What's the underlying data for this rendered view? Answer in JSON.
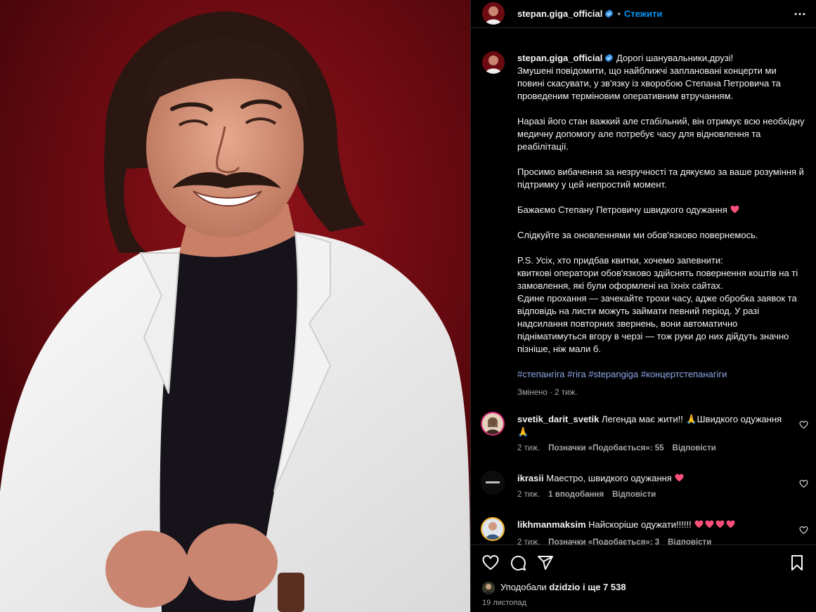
{
  "post": {
    "username": "stepan.giga_official",
    "follow_label": "Стежити",
    "dot": "•"
  },
  "caption": {
    "username": "stepan.giga_official",
    "lines": [
      "Дорогі шанувальники,друзі!\nЗмушені повідомити, що найближчі заплановані концерти ми повині скасувати, у зв'язку із хворобою Степана Петровича та проведеним терміновим оперативним втручанням.",
      "Наразі його стан важкий але стабільний, він отримує всю необхідну медичну допомогу але потребує часу для відновлення та реабілітації.",
      "Просимо вибачення за незручності та дякуємо за ваше розуміння й підтримку у цей непростий момент.",
      "Бажаємо Степану Петровичу швидкого одужання",
      "Слідкуйте за оновленнями ми обов'язково повернемось.",
      "P.S. Усіх, хто придбав квитки, хочемо запевнити:\nквиткові оператори обов'язково здійснять повернення коштів на ті замовлення, які були оформлені на їхніх сайтах.\nЄдине прохання — зачекайте трохи часу, адже обробка заявок та відповідь на листи можуть займати певний період. У разі надсилання повторних звернень, вони автоматично підніматимуться вгору в черзі — тож руки до них дійдуть значно пізніше, ніж мали б."
    ],
    "hashtags": "#степангіга #гіга #stepangiga #концертстепанагіги",
    "edited": "Змінено",
    "edited_sep": "·",
    "edited_ago": "2 тиж."
  },
  "comments": [
    {
      "username": "svetik_darit_svetik",
      "text": "Легенда має жити!! 🙏Швидкого одужання 🙏",
      "ago": "2 тиж.",
      "likes": "Позначки «Подобається»: 55",
      "reply": "Відповісти",
      "avatar_color": "#c9a27a"
    },
    {
      "username": "ikrasii",
      "text": "Маестро, швидкого одужання",
      "ago": "2 тиж.",
      "likes": "1 вподобання",
      "reply": "Відповісти",
      "avatar_color": "#111111"
    },
    {
      "username": "likhmanmaksim",
      "text": "Найскоріше одужати!!!!!!",
      "ago": "2 тиж.",
      "likes": "Позначки «Подобається»: 3",
      "reply": "Відповісти",
      "avatar_color": "#8aa0b8"
    }
  ],
  "footer": {
    "liked_by_prefix": "Уподобали",
    "liked_by_user": "dzidzio",
    "liked_by_suffix": "і ще 7 538",
    "date": "19 листопад"
  },
  "colors": {
    "accent": "#0095f6",
    "hashtag": "#8fa9e8",
    "heart": "#ff3040",
    "verified": "#3897f0"
  },
  "icons": [
    "verified-badge-icon",
    "more-options-icon",
    "heart-icon",
    "comment-icon",
    "share-icon",
    "bookmark-icon",
    "small-heart-icon",
    "pink-heart-emoji"
  ]
}
